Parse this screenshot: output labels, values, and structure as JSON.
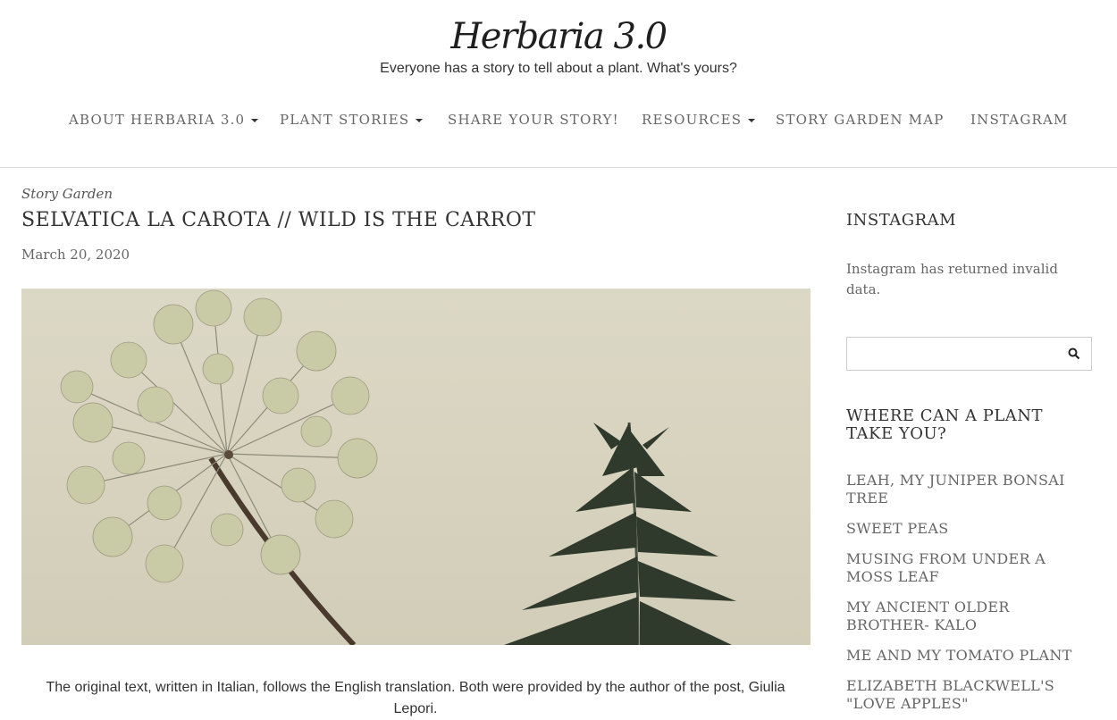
{
  "header": {
    "site_title": "Herbaria 3.0",
    "tagline": "Everyone has a story to tell about a plant. What's yours?"
  },
  "nav": {
    "items": [
      {
        "label": "ABOUT HERBARIA 3.0",
        "has_dropdown": true
      },
      {
        "label": "PLANT STORIES",
        "has_dropdown": true
      },
      {
        "label": "SHARE YOUR STORY!",
        "has_dropdown": false
      },
      {
        "label": "RESOURCES",
        "has_dropdown": true
      },
      {
        "label": "STORY GARDEN MAP",
        "has_dropdown": false
      },
      {
        "label": "INSTAGRAM",
        "has_dropdown": false
      }
    ]
  },
  "post": {
    "category": "Story Garden",
    "title": "SELVATICA LA CAROTA // WILD IS THE CARROT",
    "date": "March 20, 2020",
    "intro": "The original text, written in Italian, follows the English translation. Both were provided by the author of the post, Giulia Lepori."
  },
  "sidebar": {
    "instagram_title": "INSTAGRAM",
    "instagram_message": "Instagram has returned invalid data.",
    "search": {
      "placeholder": "",
      "icon": "search-icon"
    },
    "stories_title": "WHERE CAN A PLANT TAKE YOU?",
    "stories": [
      "LEAH, MY JUNIPER BONSAI TREE",
      "SWEET PEAS",
      "MUSING FROM UNDER A MOSS LEAF",
      "MY ANCIENT OLDER BROTHER- KALO",
      "ME AND MY TOMATO PLANT",
      "ELIZABETH BLACKWELL'S \"LOVE APPLES\""
    ]
  },
  "colors": {
    "text": "#333333",
    "muted": "#666666",
    "hero_background": "#d7d3bf",
    "flower": "#c8c9a4",
    "leaf": "#2f3a2c"
  }
}
